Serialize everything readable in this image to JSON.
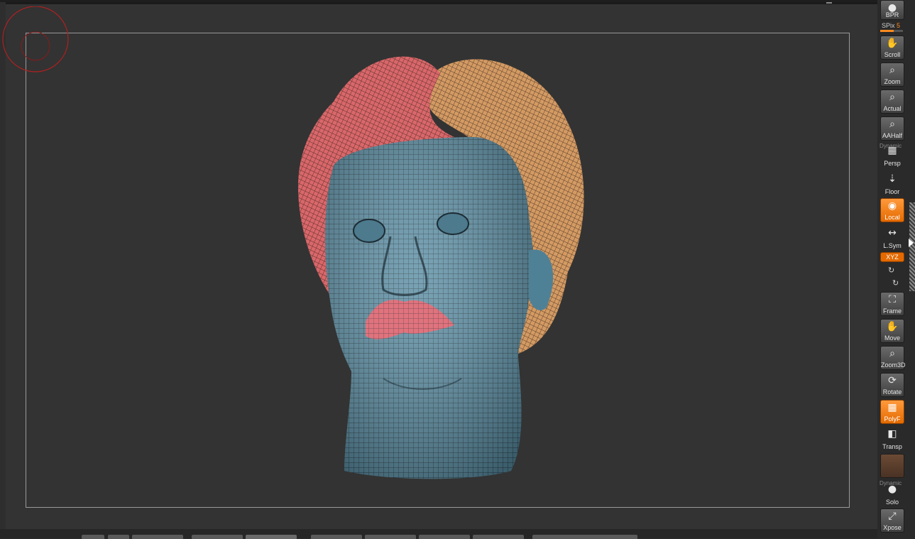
{
  "app": {
    "name": "ZBrush-style 3D viewport"
  },
  "status_text": "",
  "spix": {
    "label": "SPix",
    "value": "5",
    "fill": 0.6
  },
  "tools": [
    {
      "name": "bpr-button",
      "label": "BPR",
      "icon": "sphere-icon",
      "active": false
    },
    {
      "name": "scroll-button",
      "label": "Scroll",
      "icon": "hand-icon",
      "active": false
    },
    {
      "name": "zoom-button",
      "label": "Zoom",
      "icon": "magnifier-icon",
      "active": false
    },
    {
      "name": "actual-button",
      "label": "Actual",
      "icon": "magnifier-icon",
      "active": false
    },
    {
      "name": "aahalf-button",
      "label": "AAHalf",
      "icon": "magnifier-icon",
      "active": false
    },
    {
      "name": "persp-button",
      "label": "Persp",
      "icon": "grid-perspective-icon",
      "active": false
    },
    {
      "name": "floor-button",
      "label": "Floor",
      "icon": "floor-icon",
      "active": false
    },
    {
      "name": "local-button",
      "label": "Local",
      "icon": "local-icon",
      "active": true
    },
    {
      "name": "lsym-button",
      "label": "L.Sym",
      "icon": "symmetry-icon",
      "active": false
    },
    {
      "name": "frame-button",
      "label": "Frame",
      "icon": "frame-icon",
      "active": false
    },
    {
      "name": "move-button",
      "label": "Move",
      "icon": "hand-icon",
      "active": false
    },
    {
      "name": "zoom3d-button",
      "label": "Zoom3D",
      "icon": "magnifier-icon",
      "active": false
    },
    {
      "name": "rotate-button",
      "label": "Rotate",
      "icon": "rotate-icon",
      "active": false
    },
    {
      "name": "polyf-button",
      "label": "PolyF",
      "icon": "polyframe-icon",
      "active": true
    },
    {
      "name": "transp-button",
      "label": "Transp",
      "icon": "transparency-icon",
      "active": false
    },
    {
      "name": "ghost-button",
      "label": "",
      "icon": "ghost-icon",
      "active": false
    },
    {
      "name": "solo-button",
      "label": "Solo",
      "icon": "solo-icon",
      "active": false
    },
    {
      "name": "xpose-button",
      "label": "Xpose",
      "icon": "xpose-icon",
      "active": false
    }
  ],
  "xyz_label": "XYZ",
  "dynamic_label": "Dynamic",
  "colors": {
    "face": "#5b8fa5",
    "hair_left": "#d9676a",
    "hair_right": "#d39a63",
    "lips": "#e0737d",
    "accent": "#ff8a1e"
  }
}
